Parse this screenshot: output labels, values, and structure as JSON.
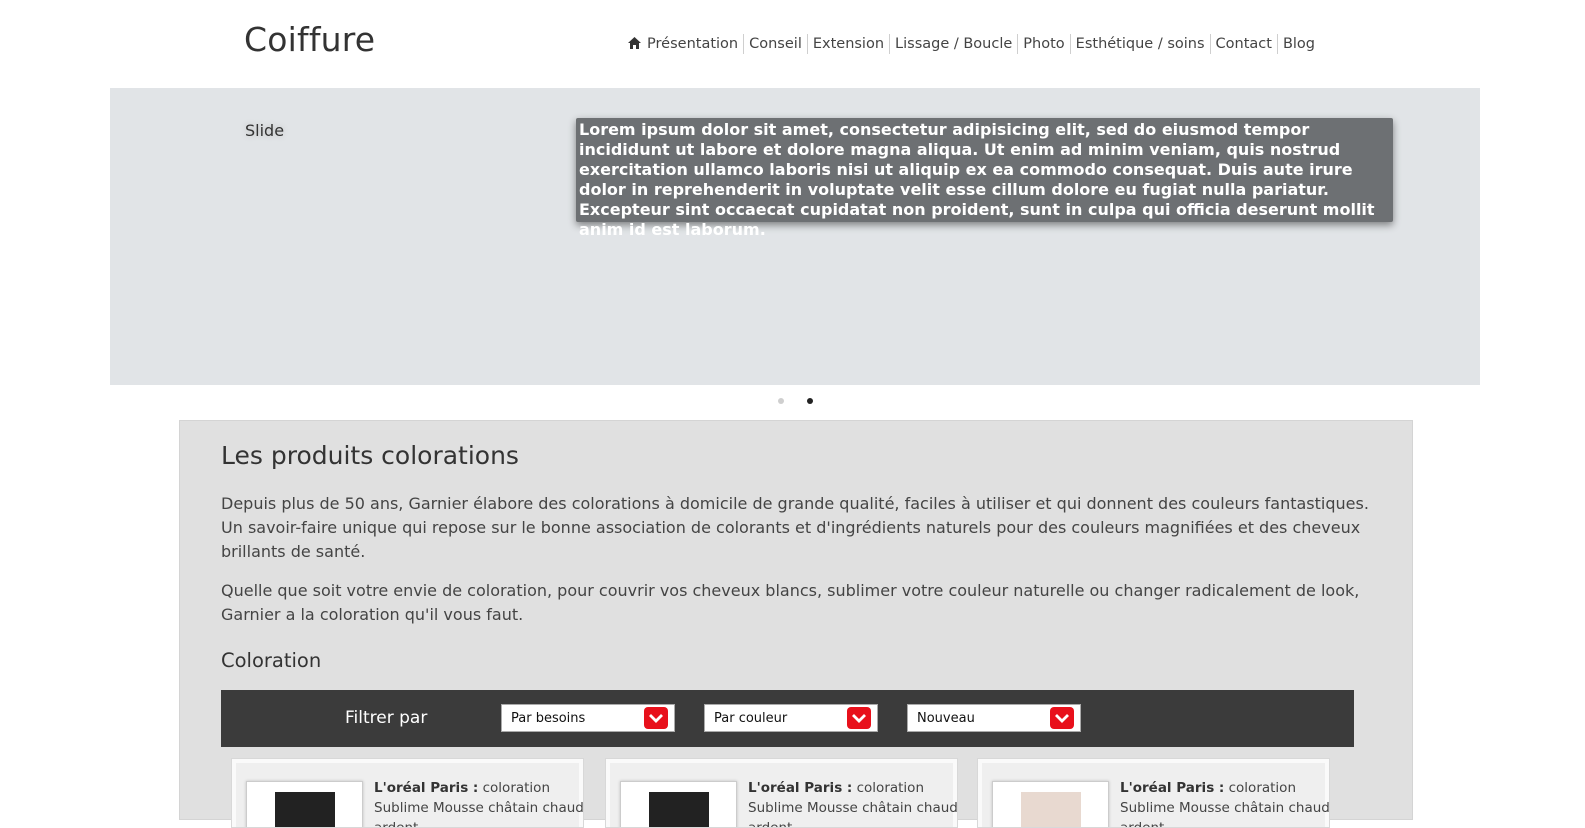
{
  "header": {
    "logo": "Coiffure",
    "nav": [
      "Présentation",
      "Conseil",
      "Extension",
      "Lissage / Boucle",
      "Photo",
      "Esthétique / soins",
      "Contact",
      "Blog"
    ]
  },
  "slider": {
    "label": "Slide",
    "caption": "Lorem ipsum dolor sit amet, consectetur adipisicing elit, sed do eiusmod tempor incididunt ut labore et dolore magna aliqua. Ut enim ad minim veniam, quis nostrud exercitation ullamco laboris nisi ut aliquip ex ea commodo consequat. Duis aute irure dolor in reprehenderit in voluptate velit esse cillum dolore eu fugiat nulla pariatur. Excepteur sint occaecat cupidatat non proident, sunt in culpa qui officia deserunt mollit anim id est laborum.",
    "active_dot": 2
  },
  "content": {
    "title": "Les produits colorations",
    "paragraph1": "Depuis plus de 50 ans, Garnier élabore des colorations à domicile de grande qualité, faciles à utiliser et qui donnent des couleurs fantastiques. Un savoir-faire unique qui repose sur le bonne association de colorants et d'ingrédients naturels pour des couleurs magnifiées et des cheveux brillants de santé.",
    "paragraph2": "Quelle que soit votre envie de coloration, pour couvrir vos cheveux blancs, sublimer votre couleur naturelle ou changer radicalement de look, Garnier a la coloration qu'il vous faut.",
    "subtitle": "Coloration"
  },
  "filter": {
    "label": "Filtrer par",
    "selects": [
      "Par besoins",
      "Par couleur",
      "Nouveau"
    ]
  },
  "products": [
    {
      "brand": "L'oréal Paris :",
      "text": "coloration Sublime Mousse châtain chaud ardent"
    },
    {
      "brand": "L'oréal Paris :",
      "text": "coloration Sublime Mousse châtain chaud ardent"
    },
    {
      "brand": "L'oréal Paris :",
      "text": "coloration Sublime Mousse châtain chaud ardent"
    }
  ],
  "colors": {
    "accent": "#e8101b",
    "filter_bg": "#3b3b3b",
    "slider_bg": "#e1e4e7",
    "content_bg": "#e0e0e0"
  }
}
